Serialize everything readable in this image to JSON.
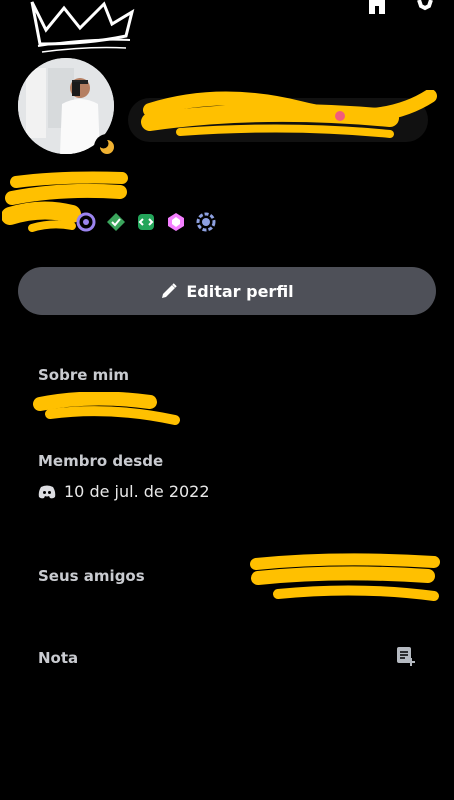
{
  "profile": {
    "edit_button_label": "Editar perfil",
    "about_label": "Sobre mim",
    "member_since_label": "Membro desde",
    "member_since_date": "10 de jul. de 2022",
    "friends_label": "Seus amigos",
    "note_label": "Nota"
  },
  "icons": {
    "top_right": [
      "home-icon",
      "gear-icon"
    ],
    "badges": [
      "nitro-badge-icon",
      "hypesquad-badge-icon",
      "active-dev-badge-icon",
      "boost-badge-icon",
      "quest-badge-icon"
    ],
    "member_since": "discord-icon",
    "note": "note-add-icon"
  },
  "colors": {
    "background": "#000000",
    "edit_button": "#4e5058",
    "scribble": "#ffc000"
  }
}
